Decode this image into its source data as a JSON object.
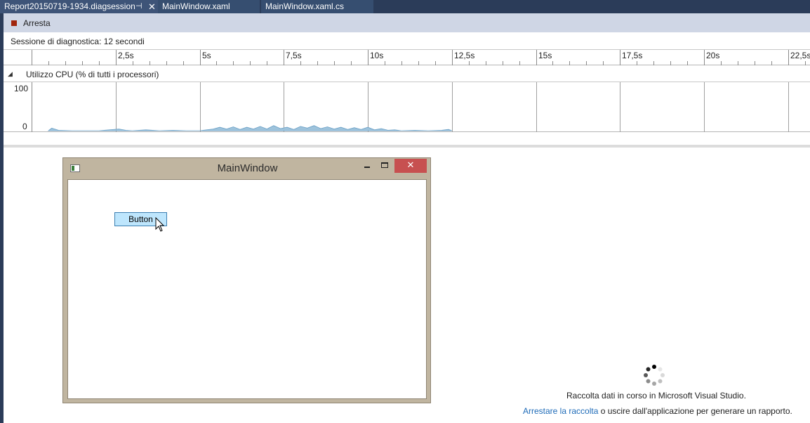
{
  "tabs": [
    {
      "label": "Report20150719-1934.diagsession",
      "active": true
    },
    {
      "label": "MainWindow.xaml",
      "active": false
    },
    {
      "label": "MainWindow.xaml.cs",
      "active": false
    }
  ],
  "tab_icons": {
    "pin": "⊣",
    "close": "✕"
  },
  "toolbar": {
    "stop_label": "Arresta"
  },
  "session": {
    "label": "Sessione di diagnostica: 12 secondi"
  },
  "ruler": {
    "ticks": [
      "2,5s",
      "5s",
      "7,5s",
      "10s",
      "12,5s",
      "15s",
      "17,5s",
      "20s",
      "22,5s"
    ]
  },
  "cpu": {
    "toggle_glyph": "◢",
    "title": "Utilizzo CPU (% di tutti i processori)",
    "y_max_label": "100",
    "y_min_label": "0"
  },
  "chart_data": {
    "type": "area",
    "title": "Utilizzo CPU (% di tutti i processori)",
    "xlabel": "",
    "ylabel": "",
    "x_unit": "s",
    "xlim": [
      0,
      23
    ],
    "ylim": [
      0,
      100
    ],
    "x_tick_labels": [
      "2,5s",
      "5s",
      "7,5s",
      "10s",
      "12,5s",
      "15s",
      "17,5s",
      "20s",
      "22,5s"
    ],
    "y_tick_labels": [
      "100",
      "0"
    ],
    "grid": true,
    "series": [
      {
        "color": "#9ec3dc",
        "x": [
          0.5,
          0.6,
          0.8,
          1.2,
          2.0,
          2.6,
          2.8,
          3.0,
          3.4,
          3.8,
          4.2,
          4.6,
          5.0,
          5.4,
          5.6,
          5.8,
          6.0,
          6.2,
          6.4,
          6.6,
          6.8,
          7.0,
          7.2,
          7.4,
          7.6,
          7.8,
          8.0,
          8.2,
          8.4,
          8.6,
          8.8,
          9.0,
          9.2,
          9.4,
          9.6,
          9.8,
          10.0,
          10.2,
          10.4,
          10.6,
          10.8,
          11.0,
          11.4,
          11.8,
          12.2,
          12.4,
          12.5
        ],
        "y": [
          0,
          6,
          1,
          0,
          0,
          4,
          1,
          0,
          2,
          0,
          1,
          0,
          0,
          4,
          8,
          4,
          9,
          3,
          8,
          4,
          10,
          4,
          12,
          5,
          8,
          3,
          10,
          6,
          12,
          5,
          9,
          4,
          8,
          3,
          7,
          3,
          8,
          2,
          5,
          1,
          2,
          0,
          1,
          0,
          1,
          3,
          0
        ]
      }
    ]
  },
  "app_window": {
    "title": "MainWindow",
    "minimize_glyph": "–",
    "close_glyph": "✕",
    "button_label": "Button"
  },
  "status": {
    "collect_message": "Raccolta dati in corso in Microsoft Visual Studio.",
    "stop_link": "Arrestare la raccolta",
    "stop_rest": " o uscire dall'applicazione per generare un rapporto."
  },
  "colors": {
    "tab_bar": "#2b3c59",
    "tab_active": "#3e5478",
    "toolbar": "#cfd6e5",
    "stop_icon": "#a1260d",
    "cpu_fill": "#9ec3dc",
    "link": "#1e6bb8",
    "close_button": "#c75050",
    "app_frame": "#c0b5a0",
    "wpf_button": "#bee6fd"
  }
}
